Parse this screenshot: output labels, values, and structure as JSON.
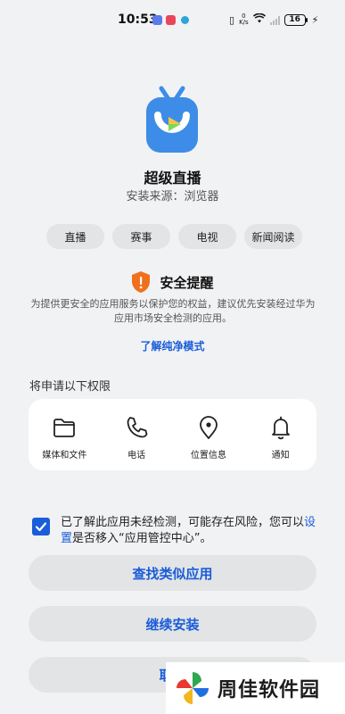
{
  "status_bar": {
    "time": "10:53",
    "net_speed_top": "0",
    "net_speed_bottom": "K/s",
    "battery": "16"
  },
  "app": {
    "name": "超级直播",
    "source": "安装来源：浏览器",
    "icon_color": "#3d8ce8"
  },
  "tags": [
    "直播",
    "赛事",
    "电视",
    "新闻阅读"
  ],
  "security": {
    "title": "安全提醒",
    "description": "为提供更安全的应用服务以保护您的权益，建议优先安装经过华为应用市场安全检测的应用。",
    "pure_mode_link": "了解纯净模式",
    "shield_color": "#f0701e"
  },
  "permissions": {
    "title": "将申请以下权限",
    "items": [
      {
        "icon": "folder-icon",
        "label": "媒体和文件"
      },
      {
        "icon": "phone-icon",
        "label": "电话"
      },
      {
        "icon": "location-icon",
        "label": "位置信息"
      },
      {
        "icon": "bell-icon",
        "label": "通知"
      }
    ]
  },
  "consent": {
    "checked": true,
    "text_before": "已了解此应用未经检测，可能存在风险，您可以",
    "link": "设置",
    "text_after": "是否移入“应用管控中心”。"
  },
  "buttons": {
    "find_similar": "查找类似应用",
    "continue_install": "继续安装",
    "cancel": "取消"
  },
  "watermark": {
    "text": "周佳软件园"
  },
  "colors": {
    "accent": "#1a5dd9",
    "background": "#f1f2f4"
  }
}
